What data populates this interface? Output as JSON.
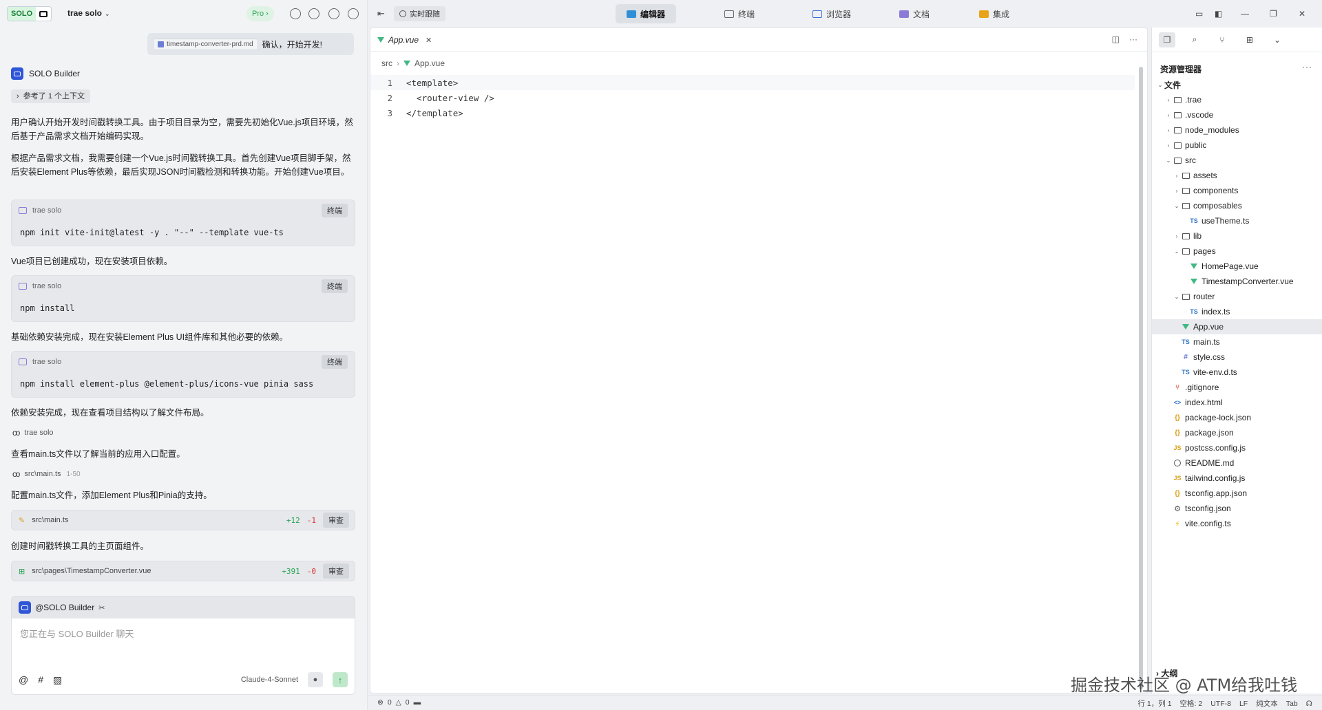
{
  "left": {
    "solo_badge": "SOLO",
    "project_name": "trae solo",
    "pro_label": "Pro",
    "user_message": {
      "file": "timestamp-converter-prd.md",
      "text": "确认，开始开发!"
    },
    "builder_name": "SOLO Builder",
    "context_ref": "参考了 1 个上下文",
    "paragraphs": [
      "用户确认开始开发时间戳转换工具。由于项目目录为空，需要先初始化Vue.js项目环境，然后基于产品需求文档开始编码实现。",
      "根据产品需求文档，我需要创建一个Vue.js时间戳转换工具。首先创建Vue项目脚手架，然后安装Element Plus等依赖，最后实现JSON时间戳检测和转换功能。开始创建Vue项目。",
      "Vue项目已创建成功，现在安装项目依赖。",
      "基础依赖安装完成，现在安装Element Plus UI组件库和其他必要的依赖。",
      "依赖安装完成，现在查看项目结构以了解文件布局。",
      "查看main.ts文件以了解当前的应用入口配置。",
      "配置main.ts文件，添加Element Plus和Pinia的支持。",
      "创建时间戳转换工具的主页面组件。"
    ],
    "commands": [
      {
        "terminal": "trae solo",
        "end_label": "终端",
        "cmd": "npm init vite-init@latest -y . \"--\" --template vue-ts"
      },
      {
        "terminal": "trae solo",
        "end_label": "终端",
        "cmd": "npm install"
      },
      {
        "terminal": "trae solo",
        "end_label": "终端",
        "cmd": "npm install element-plus @element-plus/icons-vue pinia sass"
      }
    ],
    "view_tools": [
      {
        "label": "trae solo",
        "range": ""
      },
      {
        "label": "src\\main.ts",
        "range": "1-50"
      }
    ],
    "diffs": [
      {
        "file": "src\\main.ts",
        "add": "+12",
        "del": "-1",
        "review": "审查"
      },
      {
        "file": "src\\pages\\TimestampConverter.vue",
        "add": "+391",
        "del": "-0",
        "review": "审查"
      }
    ],
    "chat": {
      "mention": "@SOLO Builder",
      "placeholder": "您正在与 SOLO Builder 聊天",
      "model": "Claude-4-Sonnet"
    }
  },
  "topbar": {
    "follow_label": "实时跟随",
    "tabs": [
      {
        "label": "编辑器",
        "active": true
      },
      {
        "label": "终端",
        "active": false
      },
      {
        "label": "浏览器",
        "active": false
      },
      {
        "label": "文档",
        "active": false
      },
      {
        "label": "集成",
        "active": false
      }
    ]
  },
  "editor": {
    "tab_label": "App.vue",
    "breadcrumb": [
      "src",
      "App.vue"
    ],
    "lines": [
      {
        "n": "1",
        "code": "<template>"
      },
      {
        "n": "2",
        "code": "  <router-view />"
      },
      {
        "n": "3",
        "code": "</template>"
      }
    ]
  },
  "explorer": {
    "title": "资源管理器",
    "section": "文件",
    "outline_label": "大纲",
    "tree": [
      {
        "name": "文件",
        "type": "root"
      },
      {
        "name": ".trae",
        "type": "folder"
      },
      {
        "name": ".vscode",
        "type": "folder"
      },
      {
        "name": "node_modules",
        "type": "folder"
      },
      {
        "name": "public",
        "type": "folder"
      },
      {
        "name": "src",
        "type": "folder-open"
      },
      {
        "name": "assets",
        "type": "folder"
      },
      {
        "name": "components",
        "type": "folder"
      },
      {
        "name": "composables",
        "type": "folder-open"
      },
      {
        "name": "useTheme.ts",
        "type": "ts"
      },
      {
        "name": "lib",
        "type": "folder"
      },
      {
        "name": "pages",
        "type": "folder-open"
      },
      {
        "name": "HomePage.vue",
        "type": "vue"
      },
      {
        "name": "TimestampConverter.vue",
        "type": "vue"
      },
      {
        "name": "router",
        "type": "folder-open"
      },
      {
        "name": "index.ts",
        "type": "ts"
      },
      {
        "name": "App.vue",
        "type": "vue"
      },
      {
        "name": "main.ts",
        "type": "ts"
      },
      {
        "name": "style.css",
        "type": "css"
      },
      {
        "name": "vite-env.d.ts",
        "type": "ts"
      },
      {
        "name": ".gitignore",
        "type": "git"
      },
      {
        "name": "index.html",
        "type": "html"
      },
      {
        "name": "package-lock.json",
        "type": "json"
      },
      {
        "name": "package.json",
        "type": "json"
      },
      {
        "name": "postcss.config.js",
        "type": "js"
      },
      {
        "name": "README.md",
        "type": "info"
      },
      {
        "name": "tailwind.config.js",
        "type": "js"
      },
      {
        "name": "tsconfig.app.json",
        "type": "json"
      },
      {
        "name": "tsconfig.json",
        "type": "gear"
      },
      {
        "name": "vite.config.ts",
        "type": "vite"
      }
    ]
  },
  "status": {
    "errors": "0",
    "warnings": "0",
    "position": "行 1，列 1",
    "indent": "空格: 2",
    "encoding": "UTF-8",
    "eol": "LF",
    "language": "纯文本",
    "tab": "Tab"
  },
  "watermark": "掘金技术社区 @ ATM给我吐钱"
}
